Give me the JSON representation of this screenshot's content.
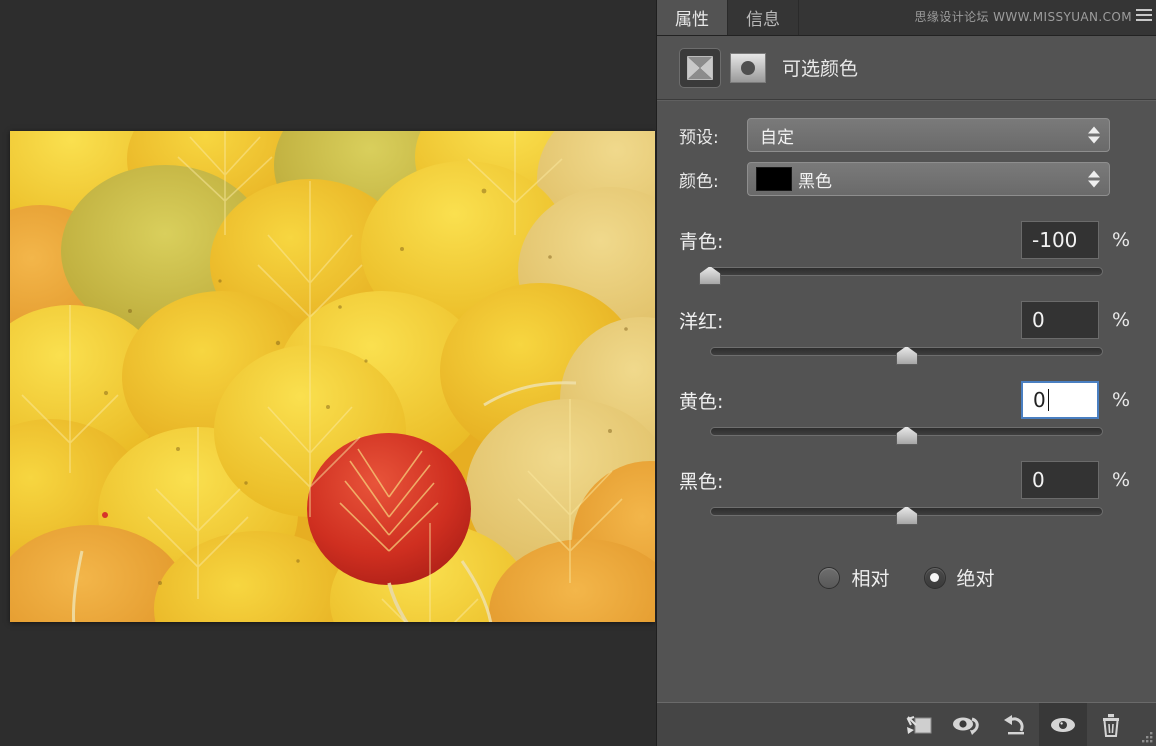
{
  "tabs": [
    {
      "label": "属性",
      "name": "tab-properties",
      "active": true
    },
    {
      "label": "信息",
      "name": "tab-info",
      "active": false
    }
  ],
  "watermark": "思缘设计论坛 WWW.MISSYUAN.COM",
  "panel": {
    "title": "可选颜色",
    "adjustment_icon": "selective-color-icon",
    "mask_icon": "layer-mask-thumbnail-icon",
    "menu_icon": "panel-menu-icon"
  },
  "preset": {
    "label": "预设:",
    "value": "自定",
    "stepper_icon": "stepper-arrows-icon"
  },
  "colors": {
    "label": "颜色:",
    "value": "黑色",
    "swatch_hex": "#000000",
    "stepper_icon": "stepper-arrows-icon"
  },
  "sliders": [
    {
      "name": "cyan",
      "label": "青色:",
      "value": "-100",
      "unit": "%",
      "percent": 0,
      "focused": false
    },
    {
      "name": "magenta",
      "label": "洋红:",
      "value": "0",
      "unit": "%",
      "percent": 50,
      "focused": false
    },
    {
      "name": "yellow",
      "label": "黄色:",
      "value": "0",
      "unit": "%",
      "percent": 50,
      "focused": true
    },
    {
      "name": "black",
      "label": "黑色:",
      "value": "0",
      "unit": "%",
      "percent": 50,
      "focused": false
    }
  ],
  "method": {
    "relative": {
      "label": "相对",
      "selected": false
    },
    "absolute": {
      "label": "绝对",
      "selected": true
    }
  },
  "footer_buttons": [
    {
      "name": "clip-to-layer-button",
      "icon": "clip-to-layer-icon",
      "active": false
    },
    {
      "name": "view-previous-state-button",
      "icon": "eye-arrow-icon",
      "active": false
    },
    {
      "name": "reset-adjustment-button",
      "icon": "reset-arrow-icon",
      "active": false
    },
    {
      "name": "toggle-visibility-button",
      "icon": "eye-icon",
      "active": true
    },
    {
      "name": "delete-adjustment-button",
      "icon": "trash-icon",
      "active": false
    }
  ],
  "document": {
    "image_alt": "yellow-aspen-leaves-photo",
    "accent_red_hex": "#cf3322",
    "accent_yellow_hex": "#f3c21c"
  }
}
